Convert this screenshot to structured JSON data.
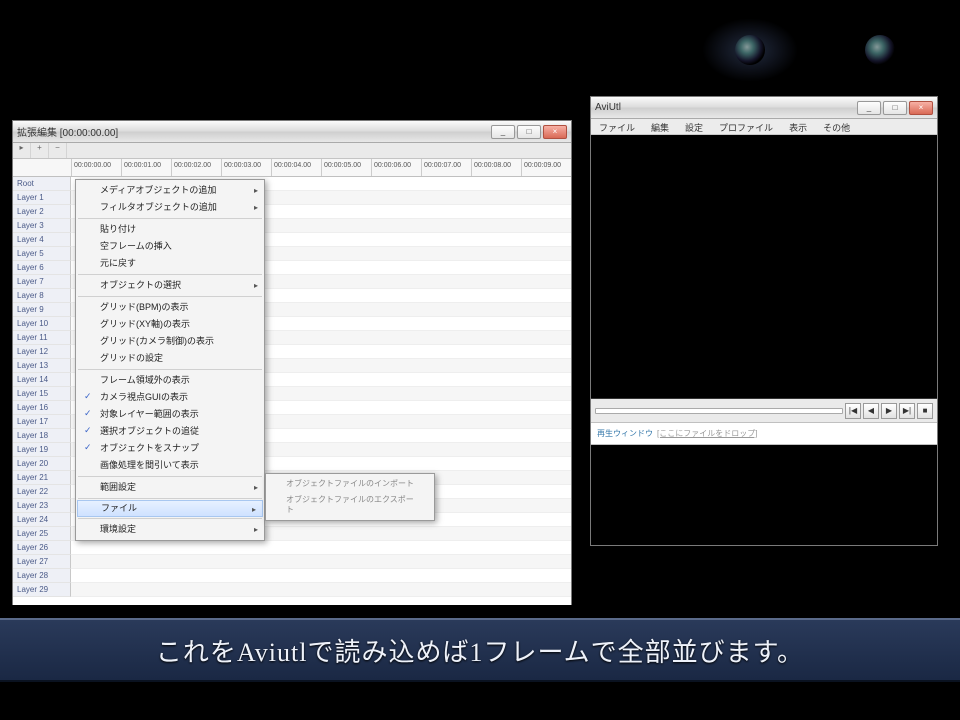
{
  "subtitle_text": "これをAviutlで読み込めば1フレームで全部並びます。",
  "timeline": {
    "title": "拡張編集  [00:00:00.00]",
    "ruler_ticks": [
      "00:00:00.00",
      "00:00:01.00",
      "00:00:02.00",
      "00:00:03.00",
      "00:00:04.00",
      "00:00:05.00",
      "00:00:06.00",
      "00:00:07.00",
      "00:00:08.00",
      "00:00:09.00"
    ],
    "layers": [
      "Root",
      "Layer 1",
      "Layer 2",
      "Layer 3",
      "Layer 4",
      "Layer 5",
      "Layer 6",
      "Layer 7",
      "Layer 8",
      "Layer 9",
      "Layer 10",
      "Layer 11",
      "Layer 12",
      "Layer 13",
      "Layer 14",
      "Layer 15",
      "Layer 16",
      "Layer 17",
      "Layer 18",
      "Layer 19",
      "Layer 20",
      "Layer 21",
      "Layer 22",
      "Layer 23",
      "Layer 24",
      "Layer 25",
      "Layer 26",
      "Layer 27",
      "Layer 28",
      "Layer 29"
    ],
    "context_menu": {
      "items": [
        {
          "label": "メディアオブジェクトの追加",
          "more": true
        },
        {
          "label": "フィルタオブジェクトの追加",
          "more": true
        },
        {
          "sep": true
        },
        {
          "label": "貼り付け"
        },
        {
          "label": "空フレームの挿入"
        },
        {
          "label": "元に戻す"
        },
        {
          "sep": true
        },
        {
          "label": "オブジェクトの選択",
          "more": true
        },
        {
          "sep": true
        },
        {
          "label": "グリッド(BPM)の表示"
        },
        {
          "label": "グリッド(XY軸)の表示"
        },
        {
          "label": "グリッド(カメラ制御)の表示"
        },
        {
          "label": "グリッドの設定"
        },
        {
          "sep": true
        },
        {
          "label": "フレーム領域外の表示"
        },
        {
          "label": "カメラ視点GUIの表示",
          "checked": true
        },
        {
          "label": "対象レイヤー範囲の表示",
          "checked": true
        },
        {
          "label": "選択オブジェクトの追従",
          "checked": true
        },
        {
          "label": "オブジェクトをスナップ",
          "checked": true
        },
        {
          "label": "画像処理を間引いて表示"
        },
        {
          "sep": true
        },
        {
          "label": "範囲設定",
          "more": true
        },
        {
          "sep": true
        },
        {
          "label": "ファイル",
          "more": true,
          "hover": true
        },
        {
          "sep": true
        },
        {
          "label": "環境設定",
          "more": true
        }
      ],
      "submenu_items": [
        {
          "label": "オブジェクトファイルのインポート"
        },
        {
          "label": "オブジェクトファイルのエクスポート"
        }
      ]
    },
    "winbtns": {
      "min": "_",
      "max": "□",
      "close": "×"
    }
  },
  "preview": {
    "title": "AviUtl",
    "menus": [
      "ファイル",
      "編集",
      "設定",
      "プロファイル",
      "表示",
      "その他"
    ],
    "play_icons": [
      "|◀",
      "◀",
      "▶",
      "▶|",
      "■"
    ],
    "drop_label": "再生ウィンドウ",
    "drop_file": "[ここにファイルをドロップ]",
    "winbtns": {
      "min": "_",
      "max": "□",
      "close": "×"
    }
  }
}
